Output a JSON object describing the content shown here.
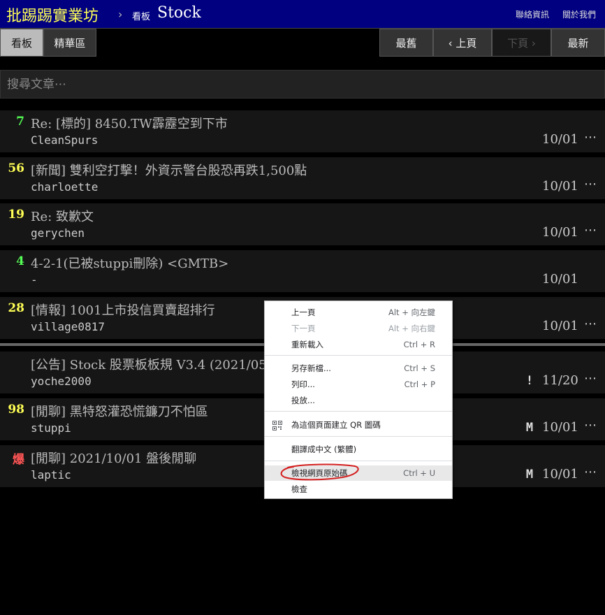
{
  "header": {
    "site_title": "批踢踢實業坊",
    "crumb_separator": "›",
    "crumb_label": "看板",
    "board_name": "Stock",
    "link_contact": "聯絡資訊",
    "link_about": "關於我們"
  },
  "nav": {
    "tab_board": "看板",
    "tab_digest": "精華區",
    "btn_oldest": "最舊",
    "btn_prev": "‹ 上頁",
    "btn_next": "下頁 ›",
    "btn_latest": "最新"
  },
  "search": {
    "placeholder": "搜尋文章⋯"
  },
  "posts": [
    {
      "nrec": "7",
      "nrec_color": "#55ff55",
      "title": "Re: [標的] 8450.TW霹靂空到下市",
      "author": "CleanSpurs",
      "mark": "",
      "date": "10/01",
      "more": "⋯"
    },
    {
      "nrec": "56",
      "nrec_color": "#ffff55",
      "title": "[新聞] 雙利空打擊！外資示警台股恐再跌1,500點",
      "author": "charloette",
      "mark": "",
      "date": "10/01",
      "more": "⋯"
    },
    {
      "nrec": "19",
      "nrec_color": "#ffff55",
      "title": "Re: 致歉文",
      "author": "gerychen",
      "mark": "",
      "date": "10/01",
      "more": "⋯"
    },
    {
      "nrec": "4",
      "nrec_color": "#55ff55",
      "title": "4-2-1(已被stuppi刪除) <GMTB>",
      "author": "-",
      "mark": "",
      "date": "10/01",
      "more": ""
    },
    {
      "nrec": "28",
      "nrec_color": "#ffff55",
      "title": "[情報] 1001上市投信買賣超排行",
      "author": "village0817",
      "mark": "",
      "date": "10/01",
      "more": "⋯"
    },
    {
      "nrec": "",
      "nrec_color": "#ffff55",
      "title": "[公告] Stock 股票板板規 V3.4 (2021/05/",
      "author": "yoche2000",
      "mark": "!",
      "date": "11/20",
      "more": "⋯"
    },
    {
      "nrec": "98",
      "nrec_color": "#ffff55",
      "title": "[閒聊] 黑特怒灌恐慌鐮刀不怕區",
      "author": "stuppi",
      "mark": "M",
      "date": "10/01",
      "more": "⋯"
    },
    {
      "nrec": "爆",
      "nrec_color": "#ff5555",
      "title": "[閒聊] 2021/10/01 盤後閒聊",
      "author": "laptic",
      "mark": "M",
      "date": "10/01",
      "more": "⋯"
    }
  ],
  "context_menu": {
    "items": [
      {
        "label": "上一頁",
        "shortcut": "Alt + 向左鍵"
      },
      {
        "label": "下一頁",
        "shortcut": "Alt + 向右鍵"
      },
      {
        "label": "重新載入",
        "shortcut": "Ctrl + R"
      },
      {
        "label": "另存新檔...",
        "shortcut": "Ctrl + S"
      },
      {
        "label": "列印...",
        "shortcut": "Ctrl + P"
      },
      {
        "label": "投放...",
        "shortcut": ""
      },
      {
        "label": "為這個頁面建立 QR 圖碼",
        "shortcut": ""
      },
      {
        "label": "翻譯成中文 (繁體)",
        "shortcut": ""
      },
      {
        "label": "檢視網頁原始碼",
        "shortcut": "Ctrl + U"
      },
      {
        "label": "檢查",
        "shortcut": ""
      }
    ],
    "qr_icon": "qr-code-icon",
    "annotation_color": "#d42020"
  }
}
